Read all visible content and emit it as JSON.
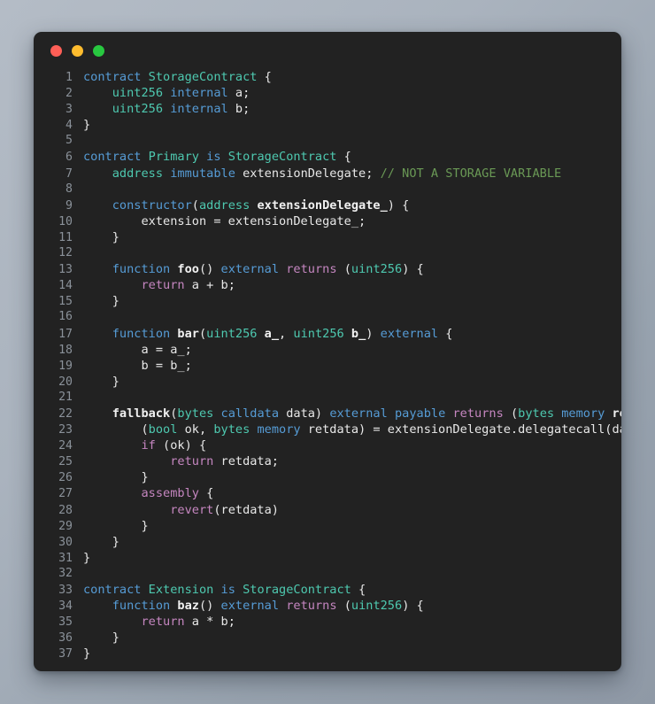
{
  "window": {
    "title": "",
    "traffic_lights": [
      {
        "name": "close",
        "color": "#FF5F57"
      },
      {
        "name": "minimize",
        "color": "#FEBC2E"
      },
      {
        "name": "maximize",
        "color": "#28C840"
      }
    ]
  },
  "editor": {
    "language": "solidity",
    "background": "#222222",
    "gutter_color": "#8a9199",
    "first_line": 1,
    "last_line": 37,
    "line_numbers": [
      1,
      2,
      3,
      4,
      5,
      6,
      7,
      8,
      9,
      10,
      11,
      12,
      13,
      14,
      15,
      16,
      17,
      18,
      19,
      20,
      21,
      22,
      23,
      24,
      25,
      26,
      27,
      28,
      29,
      30,
      31,
      32,
      33,
      34,
      35,
      36,
      37
    ],
    "theme_colors": {
      "keyword": "#569cd6",
      "type": "#4ec9b0",
      "class_name": "#4ec9b0",
      "control": "#c586c0",
      "function_name": "#f0f0f0",
      "comment": "#6a9955",
      "plain": "#e8e8e8"
    },
    "lines": [
      {
        "n": 1,
        "text": "contract StorageContract {"
      },
      {
        "n": 2,
        "text": "    uint256 internal a;"
      },
      {
        "n": 3,
        "text": "    uint256 internal b;"
      },
      {
        "n": 4,
        "text": "}"
      },
      {
        "n": 5,
        "text": ""
      },
      {
        "n": 6,
        "text": "contract Primary is StorageContract {"
      },
      {
        "n": 7,
        "text": "    address immutable extensionDelegate; // NOT A STORAGE VARIABLE"
      },
      {
        "n": 8,
        "text": ""
      },
      {
        "n": 9,
        "text": "    constructor(address extensionDelegate_) {"
      },
      {
        "n": 10,
        "text": "        extension = extensionDelegate_;"
      },
      {
        "n": 11,
        "text": "    }"
      },
      {
        "n": 12,
        "text": ""
      },
      {
        "n": 13,
        "text": "    function foo() external returns (uint256) {"
      },
      {
        "n": 14,
        "text": "        return a + b;"
      },
      {
        "n": 15,
        "text": "    }"
      },
      {
        "n": 16,
        "text": ""
      },
      {
        "n": 17,
        "text": "    function bar(uint256 a_, uint256 b_) external {"
      },
      {
        "n": 18,
        "text": "        a = a_;"
      },
      {
        "n": 19,
        "text": "        b = b_;"
      },
      {
        "n": 20,
        "text": "    }"
      },
      {
        "n": 21,
        "text": ""
      },
      {
        "n": 22,
        "text": "    fallback(bytes calldata data) external payable returns (bytes memory retdata) {"
      },
      {
        "n": 23,
        "text": "        (bool ok, bytes memory retdata) = extensionDelegate.delegatecall(data);"
      },
      {
        "n": 24,
        "text": "        if (ok) {"
      },
      {
        "n": 25,
        "text": "            return retdata;"
      },
      {
        "n": 26,
        "text": "        }"
      },
      {
        "n": 27,
        "text": "        assembly {"
      },
      {
        "n": 28,
        "text": "            revert(retdata)"
      },
      {
        "n": 29,
        "text": "        }"
      },
      {
        "n": 30,
        "text": "    }"
      },
      {
        "n": 31,
        "text": "}"
      },
      {
        "n": 32,
        "text": ""
      },
      {
        "n": 33,
        "text": "contract Extension is StorageContract {"
      },
      {
        "n": 34,
        "text": "    function baz() external returns (uint256) {"
      },
      {
        "n": 35,
        "text": "        return a * b;"
      },
      {
        "n": 36,
        "text": "    }"
      },
      {
        "n": 37,
        "text": "}"
      }
    ],
    "tokens": [
      [
        {
          "t": "contract",
          "c": "kw"
        },
        {
          "t": " ",
          "c": "pln"
        },
        {
          "t": "StorageContract",
          "c": "cls"
        },
        {
          "t": " {",
          "c": "pln"
        }
      ],
      [
        {
          "t": "    ",
          "c": "pln"
        },
        {
          "t": "uint256",
          "c": "typ"
        },
        {
          "t": " ",
          "c": "pln"
        },
        {
          "t": "internal",
          "c": "kw"
        },
        {
          "t": " a;",
          "c": "pln"
        }
      ],
      [
        {
          "t": "    ",
          "c": "pln"
        },
        {
          "t": "uint256",
          "c": "typ"
        },
        {
          "t": " ",
          "c": "pln"
        },
        {
          "t": "internal",
          "c": "kw"
        },
        {
          "t": " b;",
          "c": "pln"
        }
      ],
      [
        {
          "t": "}",
          "c": "pln"
        }
      ],
      [
        {
          "t": "",
          "c": "pln"
        }
      ],
      [
        {
          "t": "contract",
          "c": "kw"
        },
        {
          "t": " ",
          "c": "pln"
        },
        {
          "t": "Primary",
          "c": "cls"
        },
        {
          "t": " ",
          "c": "pln"
        },
        {
          "t": "is",
          "c": "kw"
        },
        {
          "t": " ",
          "c": "pln"
        },
        {
          "t": "StorageContract",
          "c": "cls"
        },
        {
          "t": " {",
          "c": "pln"
        }
      ],
      [
        {
          "t": "    ",
          "c": "pln"
        },
        {
          "t": "address",
          "c": "typ"
        },
        {
          "t": " ",
          "c": "pln"
        },
        {
          "t": "immutable",
          "c": "kw"
        },
        {
          "t": " extensionDelegate; ",
          "c": "pln"
        },
        {
          "t": "// NOT A STORAGE VARIABLE",
          "c": "cmt"
        }
      ],
      [
        {
          "t": "",
          "c": "pln"
        }
      ],
      [
        {
          "t": "    ",
          "c": "pln"
        },
        {
          "t": "constructor",
          "c": "kw"
        },
        {
          "t": "(",
          "c": "pln"
        },
        {
          "t": "address",
          "c": "typ"
        },
        {
          "t": " ",
          "c": "pln"
        },
        {
          "t": "extensionDelegate_",
          "c": "bld"
        },
        {
          "t": ") {",
          "c": "pln"
        }
      ],
      [
        {
          "t": "        extension = extensionDelegate_;",
          "c": "pln"
        }
      ],
      [
        {
          "t": "    }",
          "c": "pln"
        }
      ],
      [
        {
          "t": "",
          "c": "pln"
        }
      ],
      [
        {
          "t": "    ",
          "c": "pln"
        },
        {
          "t": "function",
          "c": "kw"
        },
        {
          "t": " ",
          "c": "pln"
        },
        {
          "t": "foo",
          "c": "fn"
        },
        {
          "t": "() ",
          "c": "pln"
        },
        {
          "t": "external",
          "c": "kw"
        },
        {
          "t": " ",
          "c": "pln"
        },
        {
          "t": "returns",
          "c": "ctl"
        },
        {
          "t": " (",
          "c": "pln"
        },
        {
          "t": "uint256",
          "c": "typ"
        },
        {
          "t": ") {",
          "c": "pln"
        }
      ],
      [
        {
          "t": "        ",
          "c": "pln"
        },
        {
          "t": "return",
          "c": "ctl"
        },
        {
          "t": " a + b;",
          "c": "pln"
        }
      ],
      [
        {
          "t": "    }",
          "c": "pln"
        }
      ],
      [
        {
          "t": "",
          "c": "pln"
        }
      ],
      [
        {
          "t": "    ",
          "c": "pln"
        },
        {
          "t": "function",
          "c": "kw"
        },
        {
          "t": " ",
          "c": "pln"
        },
        {
          "t": "bar",
          "c": "fn"
        },
        {
          "t": "(",
          "c": "pln"
        },
        {
          "t": "uint256",
          "c": "typ"
        },
        {
          "t": " ",
          "c": "pln"
        },
        {
          "t": "a_",
          "c": "bld"
        },
        {
          "t": ", ",
          "c": "pln"
        },
        {
          "t": "uint256",
          "c": "typ"
        },
        {
          "t": " ",
          "c": "pln"
        },
        {
          "t": "b_",
          "c": "bld"
        },
        {
          "t": ") ",
          "c": "pln"
        },
        {
          "t": "external",
          "c": "kw"
        },
        {
          "t": " {",
          "c": "pln"
        }
      ],
      [
        {
          "t": "        a = a_;",
          "c": "pln"
        }
      ],
      [
        {
          "t": "        b = b_;",
          "c": "pln"
        }
      ],
      [
        {
          "t": "    }",
          "c": "pln"
        }
      ],
      [
        {
          "t": "",
          "c": "pln"
        }
      ],
      [
        {
          "t": "    ",
          "c": "pln"
        },
        {
          "t": "fallback",
          "c": "fn"
        },
        {
          "t": "(",
          "c": "pln"
        },
        {
          "t": "bytes",
          "c": "typ"
        },
        {
          "t": " ",
          "c": "pln"
        },
        {
          "t": "calldata",
          "c": "kw"
        },
        {
          "t": " data) ",
          "c": "pln"
        },
        {
          "t": "external",
          "c": "kw"
        },
        {
          "t": " ",
          "c": "pln"
        },
        {
          "t": "payable",
          "c": "kw"
        },
        {
          "t": " ",
          "c": "pln"
        },
        {
          "t": "returns",
          "c": "ctl"
        },
        {
          "t": " (",
          "c": "pln"
        },
        {
          "t": "bytes",
          "c": "typ"
        },
        {
          "t": " ",
          "c": "pln"
        },
        {
          "t": "memory",
          "c": "kw"
        },
        {
          "t": " ",
          "c": "pln"
        },
        {
          "t": "retdata",
          "c": "bld"
        },
        {
          "t": ") {",
          "c": "pln"
        }
      ],
      [
        {
          "t": "        (",
          "c": "pln"
        },
        {
          "t": "bool",
          "c": "typ"
        },
        {
          "t": " ok, ",
          "c": "pln"
        },
        {
          "t": "bytes",
          "c": "typ"
        },
        {
          "t": " ",
          "c": "pln"
        },
        {
          "t": "memory",
          "c": "kw"
        },
        {
          "t": " retdata) = extensionDelegate.delegatecall(data);",
          "c": "pln"
        }
      ],
      [
        {
          "t": "        ",
          "c": "pln"
        },
        {
          "t": "if",
          "c": "ctl"
        },
        {
          "t": " (ok) {",
          "c": "pln"
        }
      ],
      [
        {
          "t": "            ",
          "c": "pln"
        },
        {
          "t": "return",
          "c": "ctl"
        },
        {
          "t": " retdata;",
          "c": "pln"
        }
      ],
      [
        {
          "t": "        }",
          "c": "pln"
        }
      ],
      [
        {
          "t": "        ",
          "c": "pln"
        },
        {
          "t": "assembly",
          "c": "ctl"
        },
        {
          "t": " {",
          "c": "pln"
        }
      ],
      [
        {
          "t": "            ",
          "c": "pln"
        },
        {
          "t": "revert",
          "c": "ctl"
        },
        {
          "t": "(retdata)",
          "c": "pln"
        }
      ],
      [
        {
          "t": "        }",
          "c": "pln"
        }
      ],
      [
        {
          "t": "    }",
          "c": "pln"
        }
      ],
      [
        {
          "t": "}",
          "c": "pln"
        }
      ],
      [
        {
          "t": "",
          "c": "pln"
        }
      ],
      [
        {
          "t": "contract",
          "c": "kw"
        },
        {
          "t": " ",
          "c": "pln"
        },
        {
          "t": "Extension",
          "c": "cls"
        },
        {
          "t": " ",
          "c": "pln"
        },
        {
          "t": "is",
          "c": "kw"
        },
        {
          "t": " ",
          "c": "pln"
        },
        {
          "t": "StorageContract",
          "c": "cls"
        },
        {
          "t": " {",
          "c": "pln"
        }
      ],
      [
        {
          "t": "    ",
          "c": "pln"
        },
        {
          "t": "function",
          "c": "kw"
        },
        {
          "t": " ",
          "c": "pln"
        },
        {
          "t": "baz",
          "c": "fn"
        },
        {
          "t": "() ",
          "c": "pln"
        },
        {
          "t": "external",
          "c": "kw"
        },
        {
          "t": " ",
          "c": "pln"
        },
        {
          "t": "returns",
          "c": "ctl"
        },
        {
          "t": " (",
          "c": "pln"
        },
        {
          "t": "uint256",
          "c": "typ"
        },
        {
          "t": ") {",
          "c": "pln"
        }
      ],
      [
        {
          "t": "        ",
          "c": "pln"
        },
        {
          "t": "return",
          "c": "ctl"
        },
        {
          "t": " a * b;",
          "c": "pln"
        }
      ],
      [
        {
          "t": "    }",
          "c": "pln"
        }
      ],
      [
        {
          "t": "}",
          "c": "pln"
        }
      ]
    ]
  }
}
